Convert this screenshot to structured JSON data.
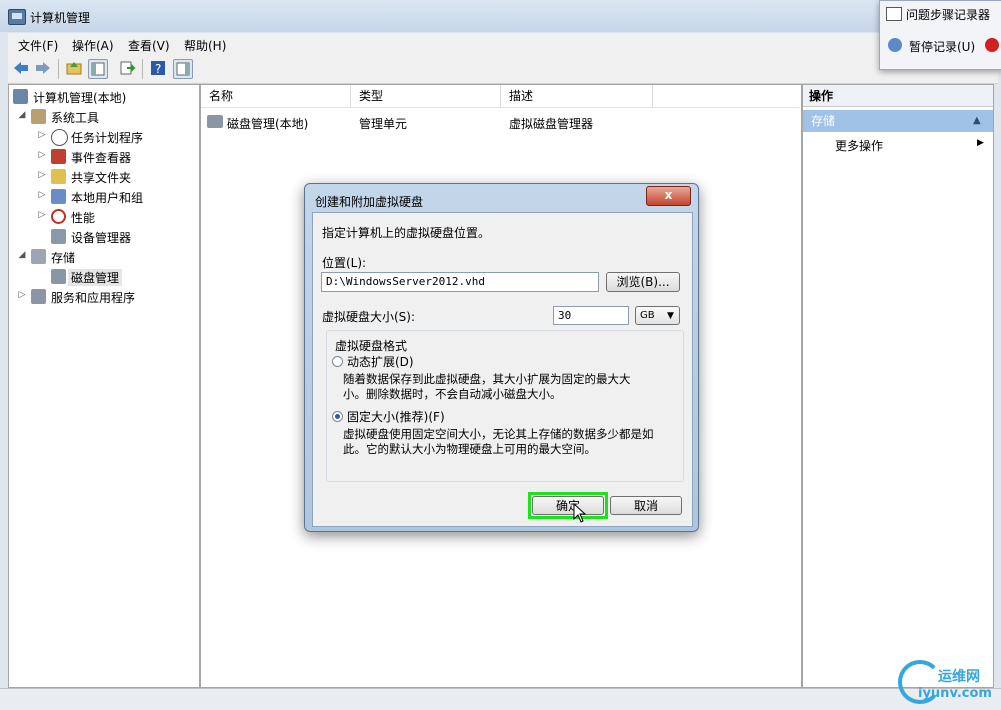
{
  "window": {
    "title": "计算机管理"
  },
  "menu": [
    "文件(F)",
    "操作(A)",
    "查看(V)",
    "帮助(H)"
  ],
  "tree": {
    "root": "计算机管理(本地)",
    "system_tools": "系统工具",
    "task_scheduler": "任务计划程序",
    "event_viewer": "事件查看器",
    "shared_folders": "共享文件夹",
    "local_users": "本地用户和组",
    "performance": "性能",
    "device_manager": "设备管理器",
    "storage": "存储",
    "disk_management": "磁盘管理",
    "services": "服务和应用程序"
  },
  "list": {
    "columns": [
      "名称",
      "类型",
      "描述"
    ],
    "rows": [
      {
        "name": "磁盘管理(本地)",
        "type": "管理单元",
        "desc": "虚拟磁盘管理器"
      }
    ]
  },
  "actions": {
    "header": "操作",
    "section": "存储",
    "more": "更多操作"
  },
  "recorder": {
    "title": "问题步骤记录器",
    "pause": "暂停记录(U)"
  },
  "dialog": {
    "title": "创建和附加虚拟硬盘",
    "close": "x",
    "instruction": "指定计算机上的虚拟硬盘位置。",
    "location_label": "位置(L):",
    "location_value": "D:\\WindowsServer2012.vhd",
    "browse": "浏览(B)...",
    "size_label": "虚拟硬盘大小(S):",
    "size_value": "30",
    "size_unit": "GB",
    "format_group": "虚拟硬盘格式",
    "dynamic_label": "动态扩展(D)",
    "dynamic_desc1": "随着数据保存到此虚拟硬盘，其大小扩展为固定的最大大",
    "dynamic_desc2": "小。删除数据时，不会自动减小磁盘大小。",
    "fixed_label": "固定大小(推荐)(F)",
    "fixed_desc1": "虚拟硬盘使用固定空间大小，无论其上存储的数据多少都是如",
    "fixed_desc2": "此。它的默认大小为物理硬盘上可用的最大空间。",
    "ok": "确定",
    "cancel": "取消",
    "selected_format": "fixed"
  },
  "watermark": {
    "cn": "运维网",
    "url": "iyunv.com"
  },
  "colors": {
    "accent": "#9fc2e6",
    "highlight": "#19e619",
    "watermark": "#35a7dd"
  }
}
